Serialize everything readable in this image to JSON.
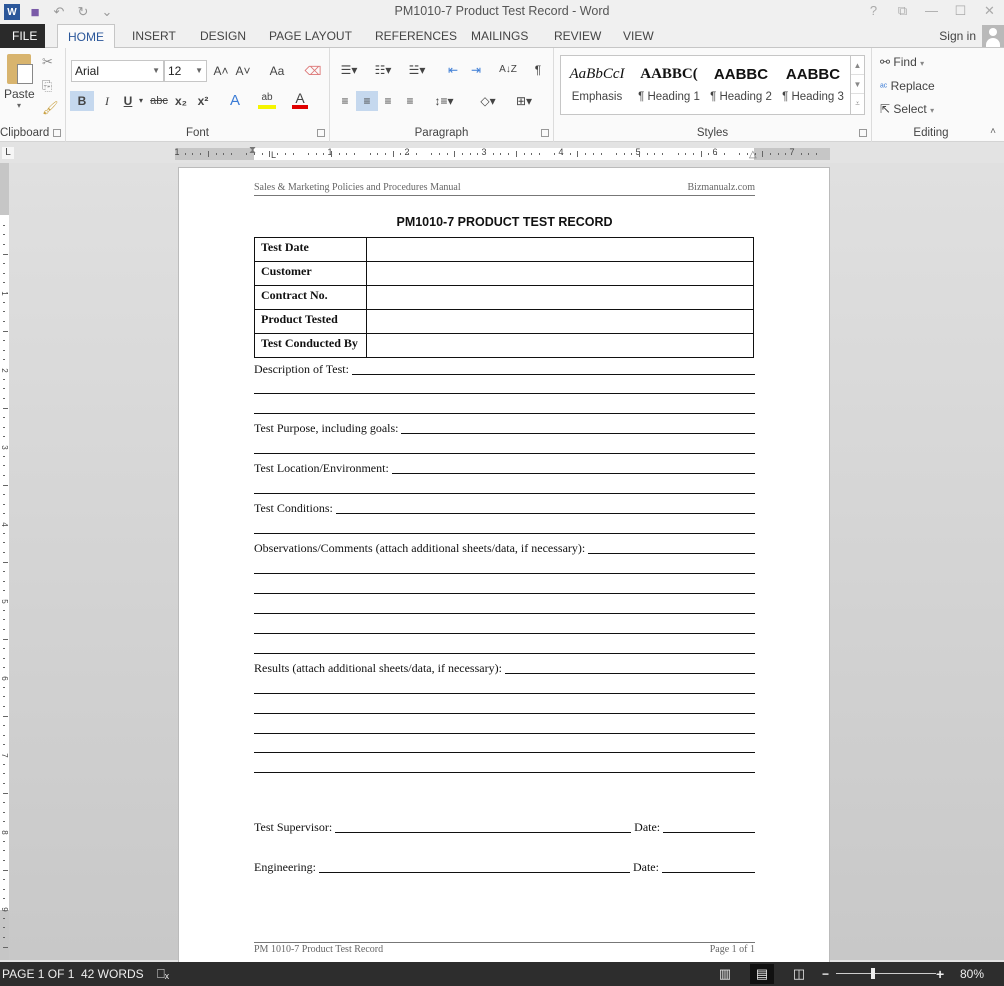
{
  "window": {
    "title": "PM1010-7 Product Test Record - Word",
    "controls": [
      "?",
      "⧉",
      "—",
      "☐",
      "✕"
    ]
  },
  "qat": {
    "app_icon": "W",
    "save_icon": "💾",
    "undo_icon": "↶",
    "redo_icon": "↻",
    "customize_icon": "⌄"
  },
  "tabs": [
    "FILE",
    "HOME",
    "INSERT",
    "DESIGN",
    "PAGE LAYOUT",
    "REFERENCES",
    "MAILINGS",
    "REVIEW",
    "VIEW"
  ],
  "active_tab": "HOME",
  "account": {
    "sign_in": "Sign in"
  },
  "ribbon": {
    "clipboard": {
      "label": "Clipboard",
      "paste": "Paste"
    },
    "font": {
      "label": "Font",
      "font_name": "Arial",
      "font_size": "12",
      "grow": "A˄",
      "shrink": "A˅",
      "change_case": "Aa",
      "bold": "B",
      "italic": "I",
      "underline": "U",
      "strikethrough": "abc",
      "subscript": "x₂",
      "superscript": "x²",
      "text_effects": "A",
      "highlight": "ab",
      "font_color": "A",
      "highlight_color": "#f5f500",
      "font_color_value": "#e00000"
    },
    "paragraph": {
      "label": "Paragraph",
      "pilcrow": "¶",
      "sort": "A↓Z"
    },
    "styles": {
      "label": "Styles",
      "items": [
        {
          "preview": "AaBbCcI",
          "name": "Emphasis"
        },
        {
          "preview": "AABBC(",
          "name": "¶ Heading 1"
        },
        {
          "preview": "AABBC",
          "name": "¶ Heading 2"
        },
        {
          "preview": "AABBC",
          "name": "¶ Heading 3"
        }
      ]
    },
    "editing": {
      "label": "Editing",
      "find": "Find",
      "replace": "Replace",
      "select": "Select"
    }
  },
  "ruler": {
    "horizontal_numbers": [
      "1",
      "1",
      "2",
      "3",
      "4",
      "5",
      "6",
      "7"
    ],
    "vertical_numbers": [
      "1",
      "2",
      "3",
      "4",
      "5",
      "6",
      "7",
      "8",
      "9"
    ]
  },
  "document": {
    "header_left": "Sales & Marketing Policies and Procedures Manual",
    "header_right": "Bizmanualz.com",
    "title": "PM1010-7 PRODUCT TEST RECORD",
    "table_rows": [
      "Test Date",
      "Customer",
      "Contract No.",
      "Product Tested",
      "Test Conducted By"
    ],
    "fields": {
      "description": "Description of Test:",
      "purpose": "Test Purpose, including goals:",
      "location": "Test Location/Environment:",
      "conditions": "Test Conditions:",
      "observations": "Observations/Comments (attach additional sheets/data, if necessary):",
      "results": "Results (attach additional sheets/data, if necessary):"
    },
    "signatures": {
      "supervisor": "Test Supervisor:",
      "engineering": "Engineering:",
      "date": "Date:"
    },
    "footer_left": "PM 1010-7 Product Test Record",
    "footer_right": "Page 1 of 1"
  },
  "status": {
    "page": "PAGE 1 OF 1",
    "words": "42 WORDS",
    "proofing_icon": "📖",
    "zoom": "80%",
    "zoom_minus": "−",
    "zoom_plus": "+"
  }
}
